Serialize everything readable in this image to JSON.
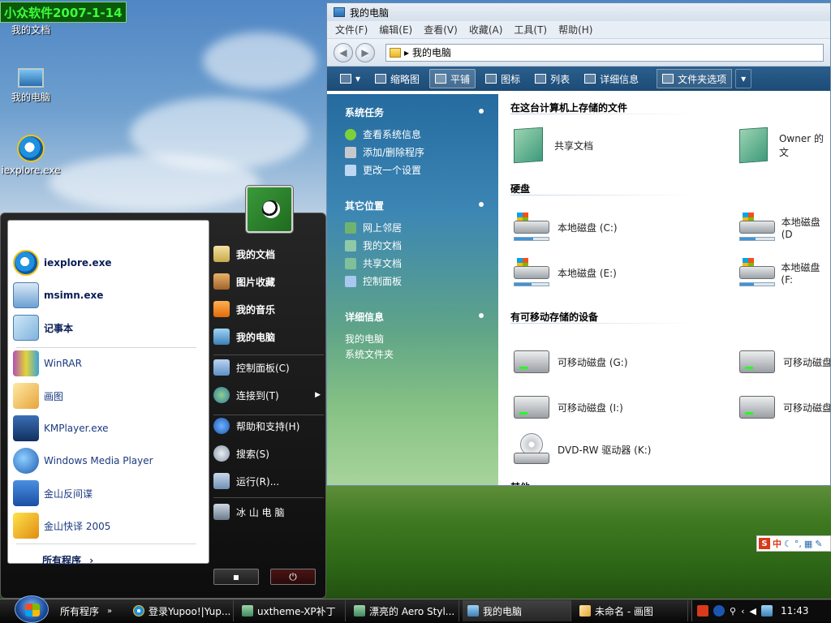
{
  "watermark": "小众软件2007-1-14",
  "desktop": {
    "icons": [
      "我的文档",
      "我的电脑",
      "iexplore.exe"
    ]
  },
  "explorer": {
    "title": "我的电脑",
    "menu": [
      "文件(F)",
      "编辑(E)",
      "查看(V)",
      "收藏(A)",
      "工具(T)",
      "帮助(H)"
    ],
    "address": "我的电脑",
    "toolbar": {
      "thumbnails": "缩略图",
      "tiles": "平铺",
      "icons": "图标",
      "list": "列表",
      "details": "详细信息",
      "folder_options": "文件夹选项"
    },
    "left_pane": {
      "system_tasks_title": "系统任务",
      "system_tasks": [
        "查看系统信息",
        "添加/删除程序",
        "更改一个设置"
      ],
      "other_places_title": "其它位置",
      "other_places": [
        "网上邻居",
        "我的文档",
        "共享文档",
        "控制面板"
      ],
      "details_title": "详细信息",
      "details_name": "我的电脑",
      "details_type": "系统文件夹"
    },
    "groups": {
      "stored_files_title": "在这台计算机上存储的文件",
      "stored_files": [
        "共享文档",
        "Owner 的文"
      ],
      "hard_disks_title": "硬盘",
      "hard_disks": [
        "本地磁盘 (C:)",
        "本地磁盘 (D",
        "本地磁盘 (E:)",
        "本地磁盘 (F:"
      ],
      "disk_usage": [
        0.55,
        0.45,
        0.5,
        0.4
      ],
      "removable_title": "有可移动存储的设备",
      "removable": [
        "可移动磁盘 (G:)",
        "可移动磁盘",
        "可移动磁盘 (I:)",
        "可移动磁盘",
        "DVD-RW 驱动器 (K:)"
      ],
      "other_title": "其他"
    }
  },
  "start_menu": {
    "pinned": [
      "iexplore.exe",
      "msimn.exe",
      "记事本"
    ],
    "recent": [
      "WinRAR",
      "画图",
      "KMPlayer.exe",
      "Windows Media Player",
      "金山反间谍",
      "金山快译 2005"
    ],
    "all_programs": "所有程序",
    "right_items": [
      "我的文档",
      "图片收藏",
      "我的音乐",
      "我的电脑",
      "控制面板(C)",
      "连接到(T)",
      "帮助和支持(H)",
      "搜索(S)",
      "运行(R)...",
      "冰 山 电 脑"
    ]
  },
  "ime": {
    "s_label": "S",
    "mode": "中"
  },
  "taskbar": {
    "quick_launch": "所有程序",
    "tasks": [
      "登录Yupoo!|Yup...",
      "uxtheme-XP补丁",
      "漂亮的 Aero Styl...",
      "我的电脑",
      "未命名 - 画图"
    ],
    "clock": "11:43"
  }
}
